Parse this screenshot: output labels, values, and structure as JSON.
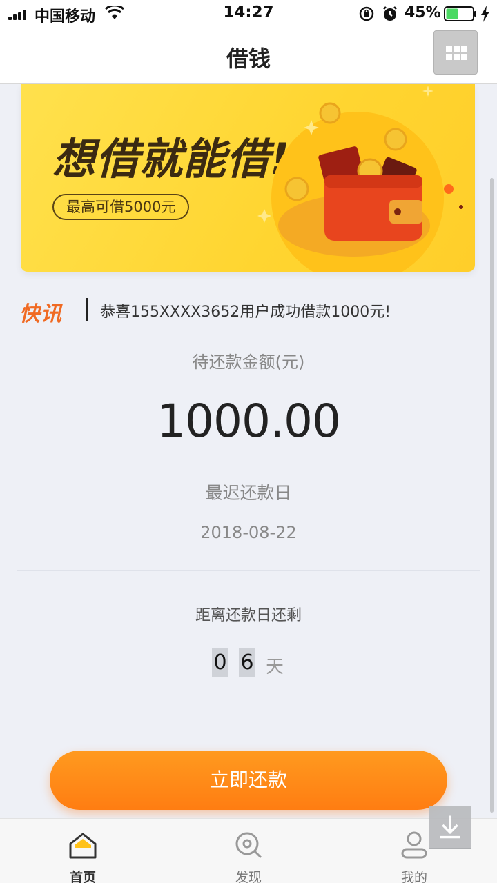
{
  "status_bar": {
    "carrier": "中国移动",
    "time": "14:27",
    "battery_percent": "45%",
    "battery_level": 0.45,
    "icons": [
      "signal-icon",
      "wifi-icon",
      "rotation-lock-icon",
      "alarm-icon",
      "battery-icon",
      "charging-icon"
    ]
  },
  "nav": {
    "title": "借钱",
    "menu_icon": "grid-menu-icon"
  },
  "banner": {
    "headline": "想借就能借!",
    "pill": "最高可借5000元",
    "colors": {
      "background": "#ffd530",
      "pill_border": "#5a4416"
    }
  },
  "ticker": {
    "logo": "快讯",
    "message": "恭喜155XXXX3652用户成功借款1000元!"
  },
  "loan": {
    "amount_label": "待还款金额(元)",
    "amount": "1000.00",
    "due_label": "最迟还款日",
    "due_date": "2018-08-22",
    "remaining_label": "距离还款日还剩",
    "remaining_digits": [
      "0",
      "6"
    ],
    "remaining_unit": "天"
  },
  "actions": {
    "repay_label": "立即还款",
    "accent_color": "#ff8a16"
  },
  "tabbar": {
    "items": [
      {
        "label": "首页",
        "icon": "home-icon",
        "active": true
      },
      {
        "label": "发现",
        "icon": "discover-icon",
        "active": false
      },
      {
        "label": "我的",
        "icon": "profile-icon",
        "active": false
      }
    ]
  },
  "floating": {
    "download_icon": "download-icon"
  }
}
